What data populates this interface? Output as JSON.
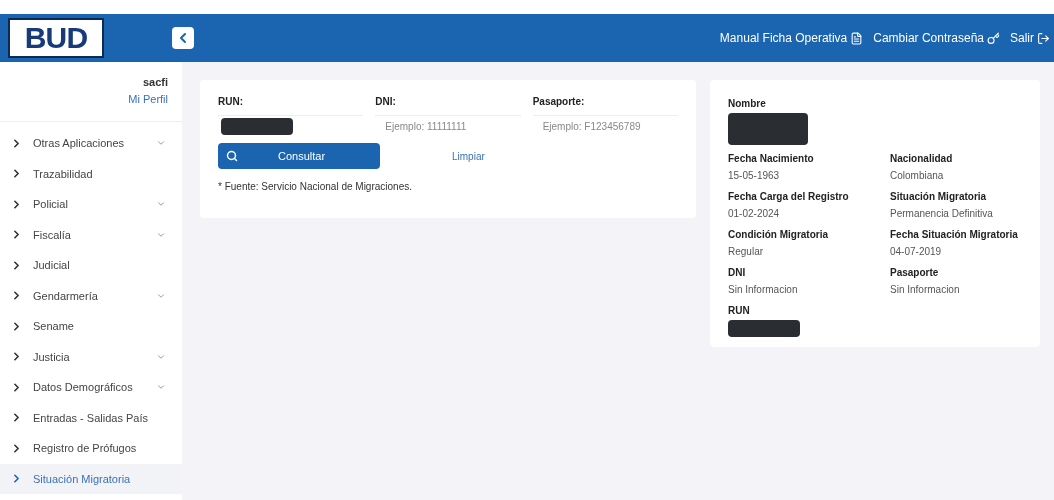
{
  "header": {
    "logo": "BUD",
    "links": [
      {
        "label": "Manual Ficha Operativa"
      },
      {
        "label": "Cambiar Contraseña"
      },
      {
        "label": "Salir"
      }
    ]
  },
  "user": {
    "name": "sacfi",
    "profile_link": "Mi Perfil"
  },
  "sidebar": {
    "items": [
      {
        "label": "Otras Aplicaciones",
        "expandable": true,
        "selected": false
      },
      {
        "label": "Trazabilidad",
        "expandable": false,
        "selected": false
      },
      {
        "label": "Policial",
        "expandable": true,
        "selected": false
      },
      {
        "label": "Fiscalía",
        "expandable": true,
        "selected": false
      },
      {
        "label": "Judicial",
        "expandable": false,
        "selected": false
      },
      {
        "label": "Gendarmería",
        "expandable": true,
        "selected": false
      },
      {
        "label": "Sename",
        "expandable": false,
        "selected": false
      },
      {
        "label": "Justicia",
        "expandable": true,
        "selected": false
      },
      {
        "label": "Datos Demográficos",
        "expandable": true,
        "selected": false
      },
      {
        "label": "Entradas - Salidas País",
        "expandable": false,
        "selected": false
      },
      {
        "label": "Registro de Prófugos",
        "expandable": false,
        "selected": false
      },
      {
        "label": "Situación Migratoria",
        "expandable": false,
        "selected": true
      }
    ]
  },
  "search": {
    "fields": [
      {
        "label": "RUN:",
        "kind": "redacted"
      },
      {
        "label": "DNI:",
        "kind": "input",
        "placeholder": "Ejemplo: 11111111"
      },
      {
        "label": "Pasaporte:",
        "kind": "input",
        "placeholder": "Ejemplo: F123456789"
      }
    ],
    "submit": "Consultar",
    "clear": "Limpiar",
    "note": "* Fuente: Servicio Nacional de Migraciones."
  },
  "result": {
    "fields": [
      {
        "label": "Nombre",
        "kind": "redacted"
      },
      {
        "label": "Fecha Nacimiento",
        "kind": "text",
        "value": "15-05-1963"
      },
      {
        "label": "Nacionalidad",
        "kind": "text",
        "value": "Colombiana"
      },
      {
        "label": "Fecha Carga del Registro",
        "kind": "text",
        "value": "01-02-2024"
      },
      {
        "label": "Situación Migratoria",
        "kind": "text",
        "value": "Permanencia Definitiva"
      },
      {
        "label": "Condición Migratoria",
        "kind": "text",
        "value": "Regular"
      },
      {
        "label": "Fecha Situación Migratoria",
        "kind": "text",
        "value": "04-07-2019"
      },
      {
        "label": "DNI",
        "kind": "text",
        "value": "Sin Informacion"
      },
      {
        "label": "Pasaporte",
        "kind": "text",
        "value": "Sin Informacion"
      },
      {
        "label": "RUN",
        "kind": "redacted"
      }
    ]
  }
}
